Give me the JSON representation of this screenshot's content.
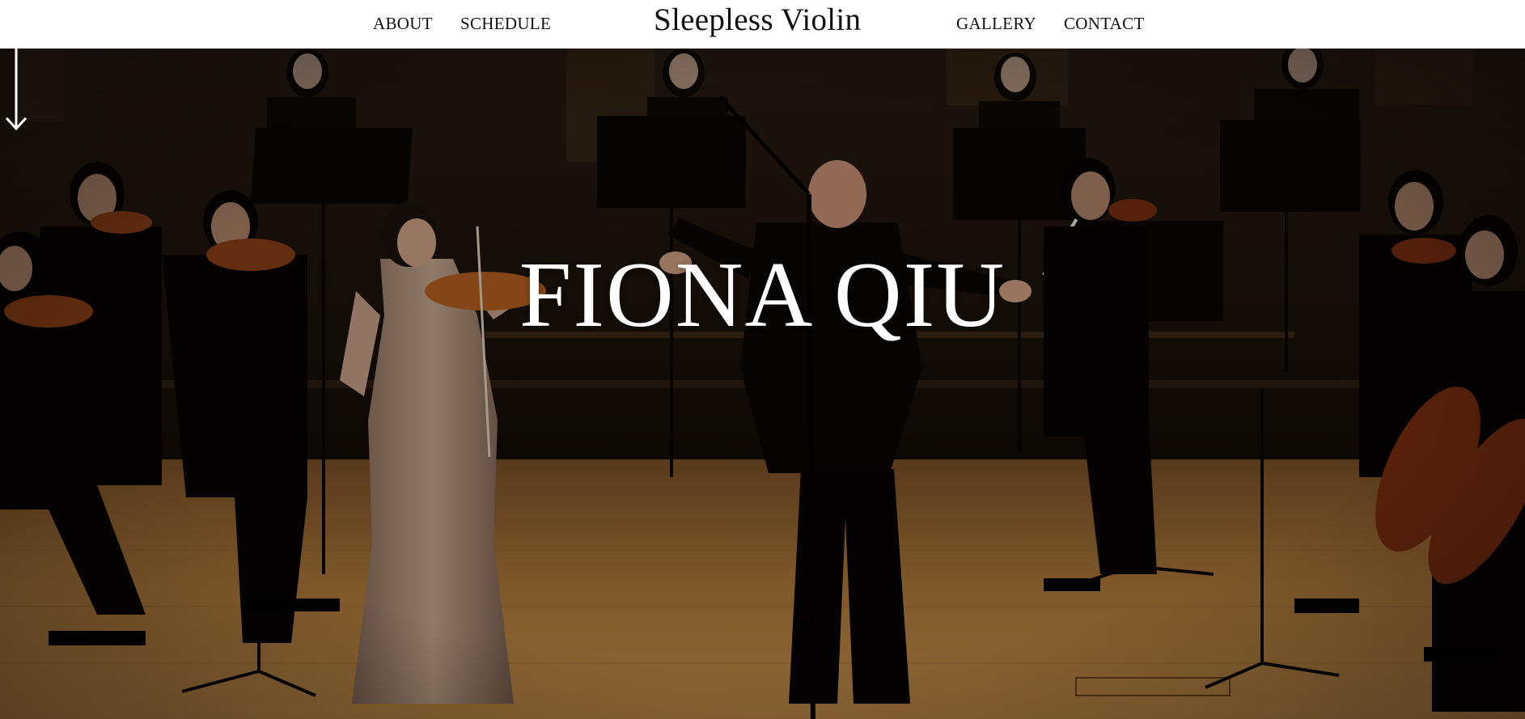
{
  "nav": {
    "left_links": [
      "ABOUT",
      "SCHEDULE"
    ],
    "brand": "Sleepless Violin",
    "right_links": [
      "GALLERY",
      "CONTACT"
    ]
  },
  "hero": {
    "title": "FIONA QIU",
    "scroll_icon": "arrow-down-icon"
  },
  "colors": {
    "nav_bg": "#ffffff",
    "nav_text": "#111111",
    "hero_text": "#ffffff",
    "stage_floor": "#c08a45",
    "backdrop": "#1c130c"
  }
}
